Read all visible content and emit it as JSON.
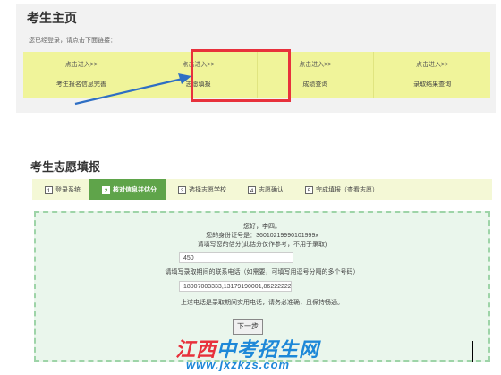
{
  "top": {
    "title": "考生主页",
    "hint": "您已经登录，请点击下面链接：",
    "links": [
      {
        "enter": "点击进入>>",
        "name": "考生报名信息完善"
      },
      {
        "enter": "点击进入>>",
        "name": "志愿填报"
      },
      {
        "enter": "点击进入>>",
        "name": "成绩查询"
      },
      {
        "enter": "点击进入>>",
        "name": "录取结果查询"
      }
    ],
    "highlight_color": "#e8313c",
    "arrow_color": "#2f6fc4"
  },
  "bottom": {
    "title": "考生志愿填报",
    "steps": [
      {
        "num": "1",
        "label": "登录系统",
        "active": false
      },
      {
        "num": "2",
        "label": "核对信息并估分",
        "active": true
      },
      {
        "num": "3",
        "label": "选择志愿学校",
        "active": false
      },
      {
        "num": "4",
        "label": "志愿确认",
        "active": false
      },
      {
        "num": "5",
        "label": "完成填报（查看志愿）",
        "active": false
      }
    ],
    "form": {
      "greeting": "您好，李四。",
      "id_line": "您的身份证号是：36010219990101999x",
      "score_prompt": "请填写您的估分(此估分仅作参考，不用于录取)",
      "score_value": "450",
      "phone_prompt": "请填写录取期间的联系电话（如需要，可填写用逗号分隔的多个号码）",
      "phone_value": "18007003333,13179190001,86222222",
      "phone_note": "上述电话是录取期间实用电话，请务必准确，且保持畅通。",
      "next_label": "下一步"
    }
  },
  "watermark": {
    "brand_red": "江西",
    "brand_blue": "中考招生网",
    "url": "www.jxzkzs.com"
  },
  "colors": {
    "link_bg": "#f0f49a",
    "step_active": "#5fa44a",
    "form_bg": "#eaf6ec"
  }
}
